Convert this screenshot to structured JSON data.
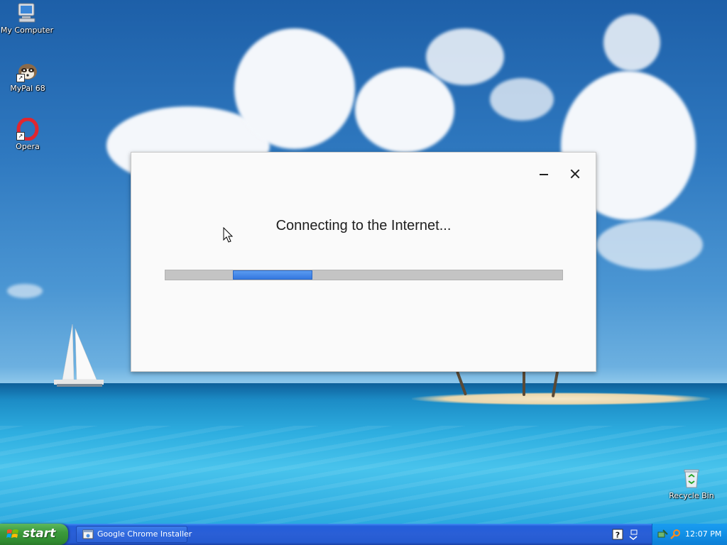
{
  "desktop": {
    "icons": [
      {
        "label": "My Computer"
      },
      {
        "label": "MyPal 68"
      },
      {
        "label": "Opera"
      },
      {
        "label": "Recycle Bin"
      }
    ]
  },
  "installer": {
    "status_text": "Connecting to the Internet...",
    "progress": {
      "state": "indeterminate",
      "segment_start": 0.17,
      "segment_end": 0.37
    }
  },
  "taskbar": {
    "start_label": "start",
    "tasks": [
      {
        "label": "Google Chrome Installer"
      }
    ],
    "clock": "12:07 PM"
  },
  "colors": {
    "progress_fill": "#3478e0",
    "progress_track": "#c4c4c4",
    "taskbar": "#245edb",
    "start_button": "#3c9a3c",
    "tray": "#1190e6"
  }
}
